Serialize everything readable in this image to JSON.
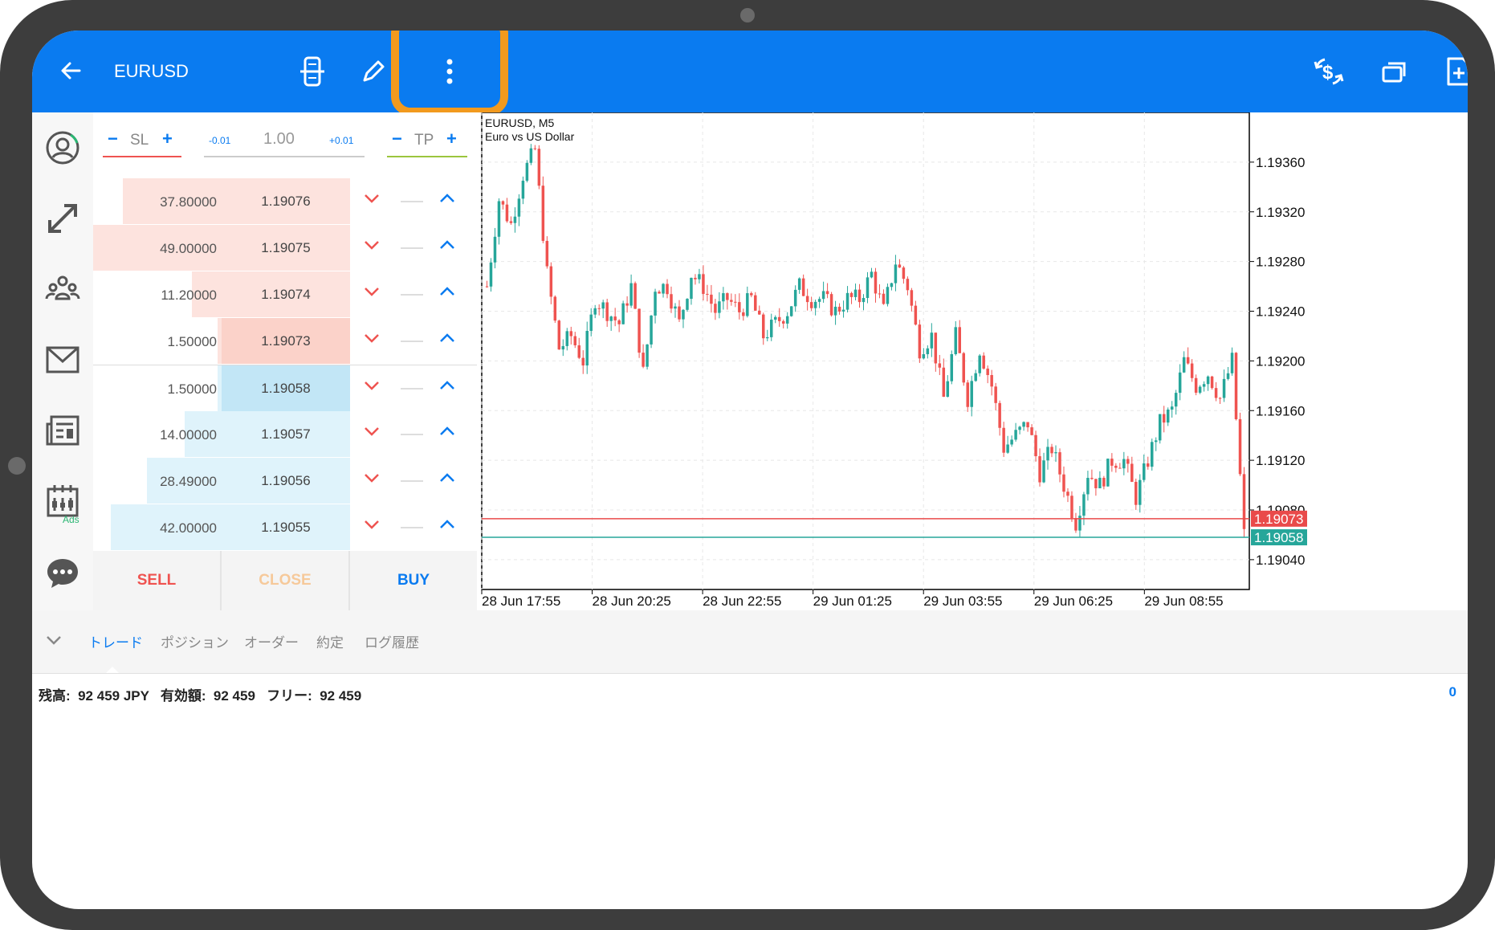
{
  "header": {
    "symbol": "EURUSD",
    "icons": [
      "back-arrow-icon",
      "depth-of-market-icon",
      "pencil-icon",
      "more-vertical-icon",
      "currency-exchange-icon",
      "windows-icon",
      "new-order-icon"
    ]
  },
  "sidebar": {
    "items": [
      "account-icon",
      "trade-icon",
      "community-icon",
      "mail-icon",
      "news-icon",
      "calendar-icon",
      "chat-icon"
    ],
    "ads_label": "Ads"
  },
  "order_panel": {
    "sl_label": "SL",
    "tp_label": "TP",
    "minus": "−",
    "plus": "+",
    "step_down": "-0.01",
    "step_up": "+0.01",
    "lot": "1.00",
    "rows": [
      {
        "volume": "37.80000",
        "price": "1.19076",
        "side": "ask"
      },
      {
        "volume": "49.00000",
        "price": "1.19075",
        "side": "ask"
      },
      {
        "volume": "11.20000",
        "price": "1.19074",
        "side": "ask"
      },
      {
        "volume": "1.50000",
        "price": "1.19073",
        "side": "ask"
      },
      {
        "volume": "1.50000",
        "price": "1.19058",
        "side": "bid"
      },
      {
        "volume": "14.00000",
        "price": "1.19057",
        "side": "bid"
      },
      {
        "volume": "28.49000",
        "price": "1.19056",
        "side": "bid"
      },
      {
        "volume": "42.00000",
        "price": "1.19055",
        "side": "bid"
      }
    ],
    "volume_fractions": [
      0.77,
      1.0,
      0.23,
      0.03,
      0.03,
      0.29,
      0.58,
      0.86
    ],
    "sell_label": "SELL",
    "close_label": "CLOSE",
    "buy_label": "BUY"
  },
  "chart_data": {
    "type": "candlestick",
    "title": "EURUSD, M5",
    "subtitle": "Euro vs US Dollar",
    "y_ticks": [
      "1.19360",
      "1.19320",
      "1.19280",
      "1.19240",
      "1.19200",
      "1.19160",
      "1.19120",
      "1.19080",
      "1.19040"
    ],
    "ylim": [
      1.19016,
      1.194
    ],
    "x_ticks": [
      "28 Jun 17:55",
      "28 Jun 20:25",
      "28 Jun 22:55",
      "29 Jun 01:25",
      "29 Jun 03:55",
      "29 Jun 06:25",
      "29 Jun 08:55"
    ],
    "ask_line": {
      "value": 1.19073,
      "label": "1.19073",
      "color": "#e94a4a"
    },
    "bid_line": {
      "value": 1.19058,
      "label": "1.19058",
      "color": "#26a69a"
    },
    "up_color": "#26a69a",
    "down_color": "#ef5350",
    "close_path": [
      1.1926,
      1.1933,
      1.1931,
      1.1935,
      1.1937,
      1.1927,
      1.1921,
      1.1922,
      1.192,
      1.1925,
      1.1924,
      1.1923,
      1.1926,
      1.1919,
      1.1926,
      1.1926,
      1.1923,
      1.1927,
      1.1926,
      1.1924,
      1.1925,
      1.1924,
      1.1925,
      1.1922,
      1.1923,
      1.1924,
      1.1926,
      1.1925,
      1.1925,
      1.1924,
      1.1925,
      1.1925,
      1.1927,
      1.1924,
      1.1928,
      1.1926,
      1.1921,
      1.1922,
      1.1917,
      1.1922,
      1.1917,
      1.1921,
      1.1918,
      1.1913,
      1.1914,
      1.1915,
      1.1911,
      1.1913,
      1.191,
      1.1907,
      1.1911,
      1.191,
      1.1912,
      1.1912,
      1.1909,
      1.1912,
      1.1915,
      1.1916,
      1.192,
      1.1918,
      1.1919,
      1.1917,
      1.192,
      1.1906
    ]
  },
  "bottom": {
    "tabs": [
      "トレード",
      "ポジション",
      "オーダー",
      "約定",
      "ログ履歴"
    ],
    "balance": "残高:  92 459 JPY   有効額:  92 459   フリー:  92 459",
    "right_value": "0"
  }
}
